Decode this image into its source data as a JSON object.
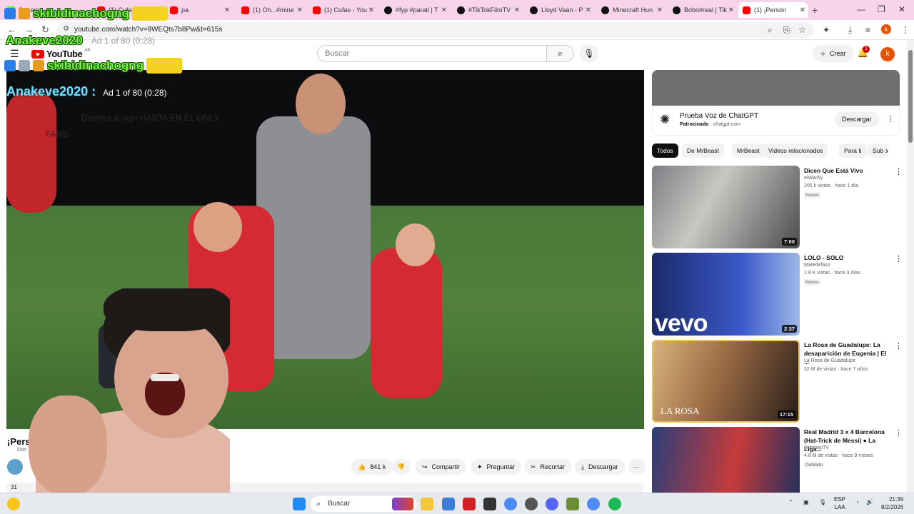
{
  "browser": {
    "tabs": [
      {
        "label": "Stream",
        "favicon": "kick-icon"
      },
      {
        "label": "(1) Cufas - You",
        "favicon": "youtube-icon"
      },
      {
        "label": "pa",
        "favicon": "youtube-icon"
      },
      {
        "label": "(1) Oh...#mine",
        "favicon": "youtube-icon"
      },
      {
        "label": "(1) Cufas - You",
        "favicon": "youtube-icon"
      },
      {
        "label": "#fyp #parati | T",
        "favicon": "tiktok-icon"
      },
      {
        "label": "#TikTokFilmTV",
        "favicon": "tiktok-icon"
      },
      {
        "label": "Lloyd Vaan - P",
        "favicon": "tiktok-icon"
      },
      {
        "label": "Minecraft Hun",
        "favicon": "tiktok-icon"
      },
      {
        "label": "Bobo#real | Tik",
        "favicon": "tiktok-icon"
      },
      {
        "label": "(1) ¡Person",
        "favicon": "youtube-icon",
        "active": true
      }
    ],
    "url": "youtube.com/watch?v=9WEQts7b8Pw&t=615s",
    "profile_letter": "k"
  },
  "youtube": {
    "logo_text": "YouTube",
    "country_code": "AR",
    "search_placeholder": "Buscar",
    "create_label": "Crear",
    "notif_count": "1",
    "avatar_letter": "k",
    "brand_color": "#ff0000"
  },
  "overlay": {
    "top_name": "skibidinachogng",
    "name2": "Anakeve2020",
    "ad_small": "Ad 1 of 80 (0:28)",
    "name3": "skibidinachogng"
  },
  "player": {
    "channel_tag": "Anakeve2020 :",
    "ad_label": "Ad 1 of 80 (0:28)",
    "ghost_line1": "Dismiss & sign HASTA EN EL ONLY",
    "ghost_line2": "FANS"
  },
  "video": {
    "title_partial": "¡Perso",
    "channel_partial": "Dob",
    "views_partial": "31"
  },
  "actions": {
    "likes": "841 k",
    "share": "Compartir",
    "ask": "Preguntar",
    "clip": "Recortar",
    "download": "Descargar"
  },
  "sidebar": {
    "ad": {
      "title": "Prueba Voz de ChatGPT",
      "sponsored": "Patrocinado",
      "domain": "chatgpt.com",
      "button": "Descargar"
    },
    "chips": [
      "Todos",
      "De MrBeast",
      "MrBeast",
      "Videos relacionados",
      "Para ti",
      "Sub"
    ],
    "recommendations": [
      {
        "title": "Dicen Que Está Vivo",
        "channel": "elWacky",
        "meta": "205 k vistas · hace 1 día",
        "badge": "Nuevo",
        "duration": "7:00"
      },
      {
        "title": "LOLO - SOLO",
        "channel": "Matedefaso",
        "meta": "1.8 K vistas · hace 3 días",
        "badge": "Nuevo",
        "duration": "2:37",
        "overlay_text": "vevo"
      },
      {
        "title": "La Rosa de Guadalupe: La desaparición de Eugenia | El ...",
        "channel": "La Rosa de Guadalupe",
        "meta": "32 M de vistas · hace 7 años",
        "badge": "",
        "duration": "17:15",
        "overlay_text": "LA ROSA"
      },
      {
        "title": "Real Madrid 3 x 4 Barcelona (Hat-Trick de Messi) ● La Liga...",
        "channel": "RptimaoTV",
        "meta": "4.8 M de vistas · hace 9 meses",
        "badge": "Doblado",
        "duration": ""
      }
    ]
  },
  "taskbar": {
    "search": "Buscar",
    "lang_top": "ESP",
    "lang_bottom": "LAA",
    "time": "21:39",
    "date": "8/2/2026"
  }
}
